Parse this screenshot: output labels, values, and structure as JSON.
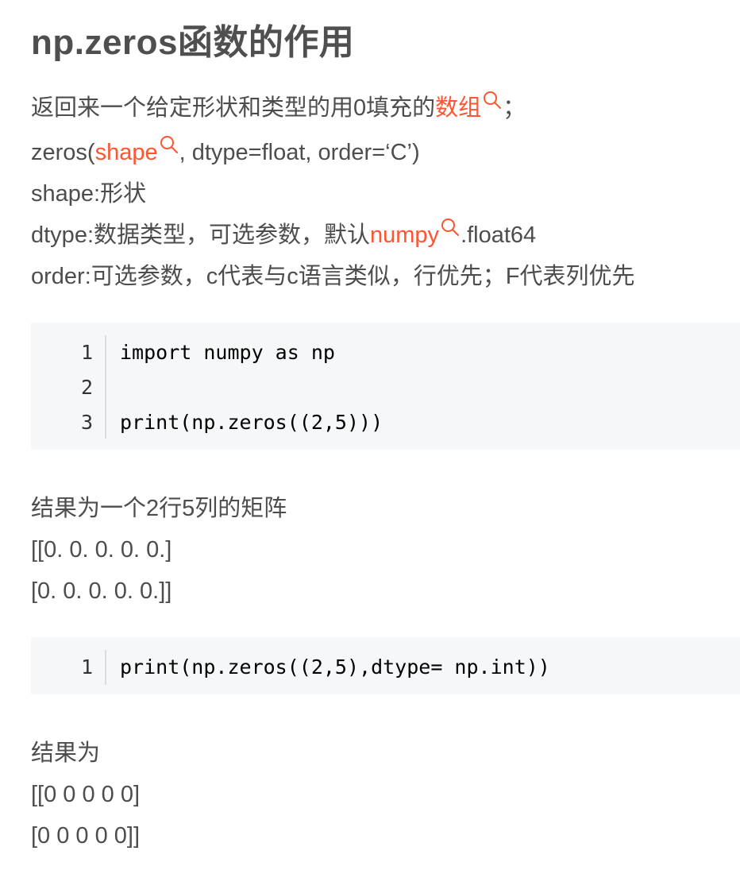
{
  "title": "np.zeros函数的作用",
  "desc": {
    "line1_pre": "返回来一个给定形状和类型的用0填充的",
    "line1_kw": "数组",
    "line1_post": "；",
    "line2_pre": "zeros(",
    "line2_kw": "shape",
    "line2_post": ", dtype=float, order=‘C’)",
    "line3": "shape:形状",
    "line4_pre": "dtype:数据类型，可选参数，默认",
    "line4_kw": "numpy",
    "line4_post": ".float64",
    "line5": "order:可选参数，c代表与c语言类似，行优先；F代表列优先"
  },
  "code1": [
    {
      "no": "1",
      "text": "import numpy as np"
    },
    {
      "no": "2",
      "text": ""
    },
    {
      "no": "3",
      "text": "print(np.zeros((2,5)))"
    }
  ],
  "result1": {
    "label": "结果为一个2行5列的矩阵",
    "row1": "[[0. 0. 0. 0. 0.]",
    "row2": "[0. 0. 0. 0. 0.]]"
  },
  "code2": [
    {
      "no": "1",
      "text": "print(np.zeros((2,5),dtype= np.int))"
    }
  ],
  "result2": {
    "label": "结果为",
    "row1": "[[0 0 0 0 0]",
    "row2": "[0 0 0 0 0]]"
  },
  "colors": {
    "keyword": "#fc5531",
    "text": "#4d4d4d",
    "code_bg": "#f6f7f8"
  },
  "icons": {
    "keyword_search": "search-icon"
  }
}
